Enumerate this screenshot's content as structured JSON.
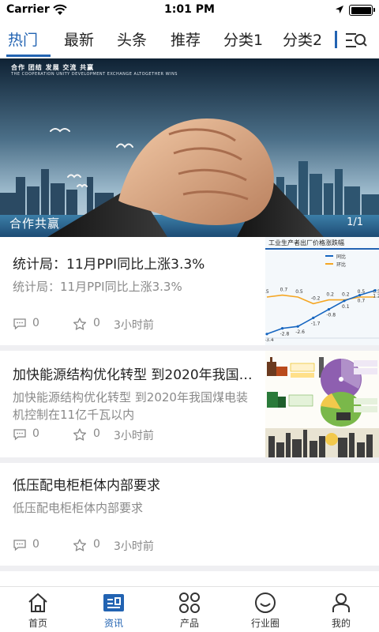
{
  "status_bar": {
    "carrier": "Carrier",
    "time": "1:01 PM"
  },
  "tabs": [
    {
      "label": "热门",
      "active": true
    },
    {
      "label": "最新",
      "active": false
    },
    {
      "label": "头条",
      "active": false
    },
    {
      "label": "推荐",
      "active": false
    },
    {
      "label": "分类1",
      "active": false
    },
    {
      "label": "分类2",
      "active": false
    }
  ],
  "banner": {
    "title": "合作共赢",
    "counter": "1/1",
    "header": "合作  团结  发展  交流  共赢",
    "subheader": "THE COOPERATION UNITY DEVELOPMENT EXCHANGE ALTOGETHER WINS"
  },
  "news": [
    {
      "title": "统计局：11月PPI同比上涨3.3%",
      "summary": "统计局：11月PPI同比上涨3.3%",
      "comments": "0",
      "likes": "0",
      "time": "3小时前",
      "thumb": {
        "chart_title": "工业生产者出厂价格涨跌幅",
        "legend_yoy": "同比",
        "legend_mom": "环比",
        "yoy_values": [
          -3.4,
          -2.8,
          -2.6,
          -1.7,
          -0.8,
          0.1,
          0.7,
          1.2
        ],
        "mom_values": [
          0.5,
          0.7,
          0.5,
          -0.2,
          0.2,
          0.2,
          0.5,
          0.5
        ],
        "yoy_labels": [
          "-3.4",
          "-2.8",
          "-2.6",
          "-1.7",
          "-0.8",
          "0.1",
          "0.7",
          "1.2"
        ],
        "mom_labels": [
          ".5",
          "0.7",
          "0.5",
          "-0.2",
          "0.2",
          "0.2",
          "0.5",
          "0.5"
        ]
      }
    },
    {
      "title": "加快能源结构优化转型 到2020年我国煤电装机控制在11亿千瓦以内",
      "summary": "加快能源结构优化转型 到2020年我国煤电装机控制在11亿千瓦以内",
      "comments": "0",
      "likes": "0",
      "time": "3小时前"
    },
    {
      "title": "低压配电柜柜体内部要求",
      "summary": "低压配电柜柜体内部要求",
      "comments": "0",
      "likes": "0",
      "time": "3小时前"
    }
  ],
  "bottom_nav": [
    {
      "label": "首页",
      "icon": "home-icon",
      "active": false
    },
    {
      "label": "资讯",
      "icon": "news-icon",
      "active": true
    },
    {
      "label": "产品",
      "icon": "grid-icon",
      "active": false
    },
    {
      "label": "行业圈",
      "icon": "smile-icon",
      "active": false
    },
    {
      "label": "我的",
      "icon": "user-icon",
      "active": false
    }
  ],
  "colors": {
    "accent": "#2263b2",
    "separator": "#efeff2",
    "meta_text": "#888888"
  }
}
